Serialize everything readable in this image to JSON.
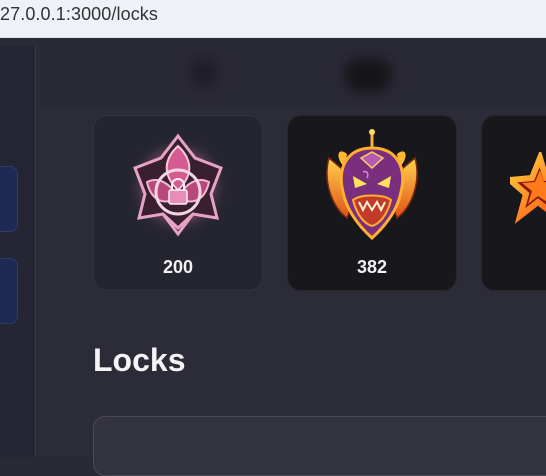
{
  "browser": {
    "url": "27.0.0.1:3000/locks"
  },
  "cards": [
    {
      "value": "200",
      "icon": "pink-lock-emblem-icon"
    },
    {
      "value": "382",
      "icon": "demon-mask-emblem-icon"
    },
    {
      "icon": "fiery-star-emblem-icon"
    }
  ],
  "main": {
    "section_title": "Locks"
  },
  "colors": {
    "background": "#2c2b38",
    "sidebar": "#252533",
    "sidebar_button": "#1f2a52",
    "card_dark": "#17171c",
    "card_light": "#252530",
    "text": "#f2f2f2"
  }
}
